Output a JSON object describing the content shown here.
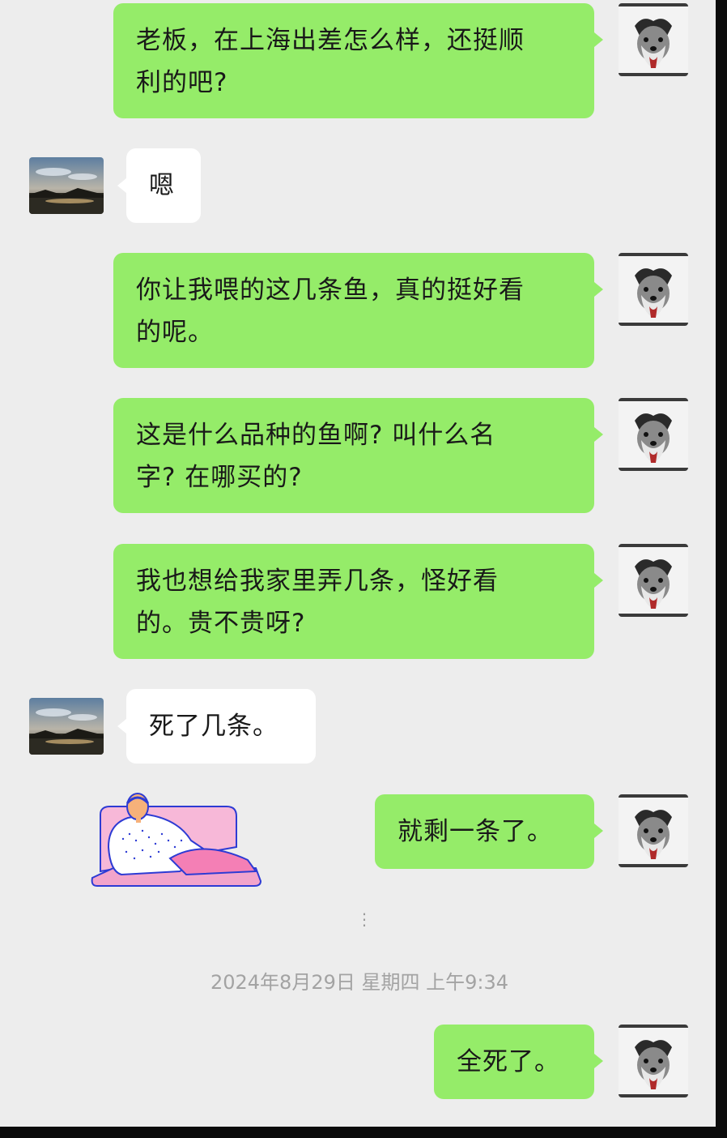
{
  "messages": [
    {
      "side": "right",
      "text": "老板，在上海出差怎么样，还挺顺利的吧?",
      "lines": [
        "老板，在上海出差怎么样，还挺顺",
        "利的吧?"
      ]
    },
    {
      "side": "left",
      "text": "嗯",
      "lines": [
        "嗯"
      ]
    },
    {
      "side": "right",
      "text": "你让我喂的这几条鱼，真的挺好看的呢。",
      "lines": [
        "你让我喂的这几条鱼，真的挺好看",
        "的呢。"
      ]
    },
    {
      "side": "right",
      "text": "这是什么品种的鱼啊? 叫什么名字? 在哪买的?",
      "lines": [
        "这是什么品种的鱼啊? 叫什么名",
        "字? 在哪买的?"
      ]
    },
    {
      "side": "right",
      "text": "我也想给我家里弄几条，怪好看的。贵不贵呀?",
      "lines": [
        "我也想给我家里弄几条，怪好看",
        "的。贵不贵呀?"
      ]
    },
    {
      "side": "left",
      "text": "死了几条。",
      "lines": [
        "死了几条。"
      ]
    },
    {
      "side": "right",
      "text": "就剩一条了。",
      "lines": [
        "就剩一条了。"
      ]
    },
    {
      "side": "right",
      "text": "全死了。",
      "lines": [
        "全死了。"
      ]
    }
  ],
  "timestamp": "2024年8月29日 星期四 上午9:34",
  "avatars": {
    "self": "schnauzer-dog-avatar",
    "contact": "sunset-landscape-avatar"
  },
  "sticker": "man-lying-in-hospital-bed-sticker",
  "colors": {
    "background": "#ededed",
    "bubble_self": "#95ec69",
    "bubble_other": "#ffffff",
    "timestamp": "#a3a3a3"
  }
}
